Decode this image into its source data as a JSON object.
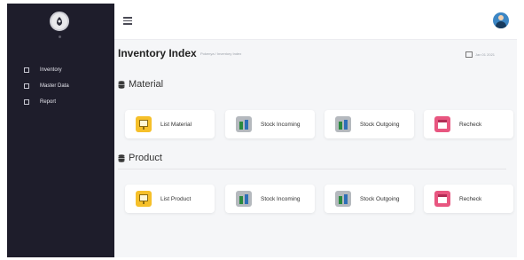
{
  "sidebar": {
    "items": [
      {
        "label": "Inventory"
      },
      {
        "label": "Master Data"
      },
      {
        "label": "Report"
      }
    ]
  },
  "header": {
    "title": "Inventory Index",
    "breadcrumb": "Pokenya / Inventory Index",
    "date": "Jan 01 2021"
  },
  "sections": [
    {
      "title": "Material",
      "cards": [
        {
          "label": "List Material",
          "icon": "monitor-icon",
          "color": "#f6c02a"
        },
        {
          "label": "Stock Incoming",
          "icon": "chart-icon",
          "color": "#b5b9be"
        },
        {
          "label": "Stock Outgoing",
          "icon": "chart-icon",
          "color": "#b5b9be"
        },
        {
          "label": "Recheck",
          "icon": "calendar-icon",
          "color": "#e85680"
        }
      ]
    },
    {
      "title": "Product",
      "cards": [
        {
          "label": "List Product",
          "icon": "monitor-icon",
          "color": "#f6c02a"
        },
        {
          "label": "Stock Incoming",
          "icon": "chart-icon",
          "color": "#b5b9be"
        },
        {
          "label": "Stock Outgoing",
          "icon": "chart-icon",
          "color": "#b5b9be"
        },
        {
          "label": "Recheck",
          "icon": "calendar-icon",
          "color": "#e85680"
        }
      ]
    }
  ],
  "colors": {
    "sidebar_bg": "#1e1d2b",
    "page_bg": "#f5f6f8",
    "accent_yellow": "#f6c02a",
    "accent_pink": "#e85680"
  }
}
